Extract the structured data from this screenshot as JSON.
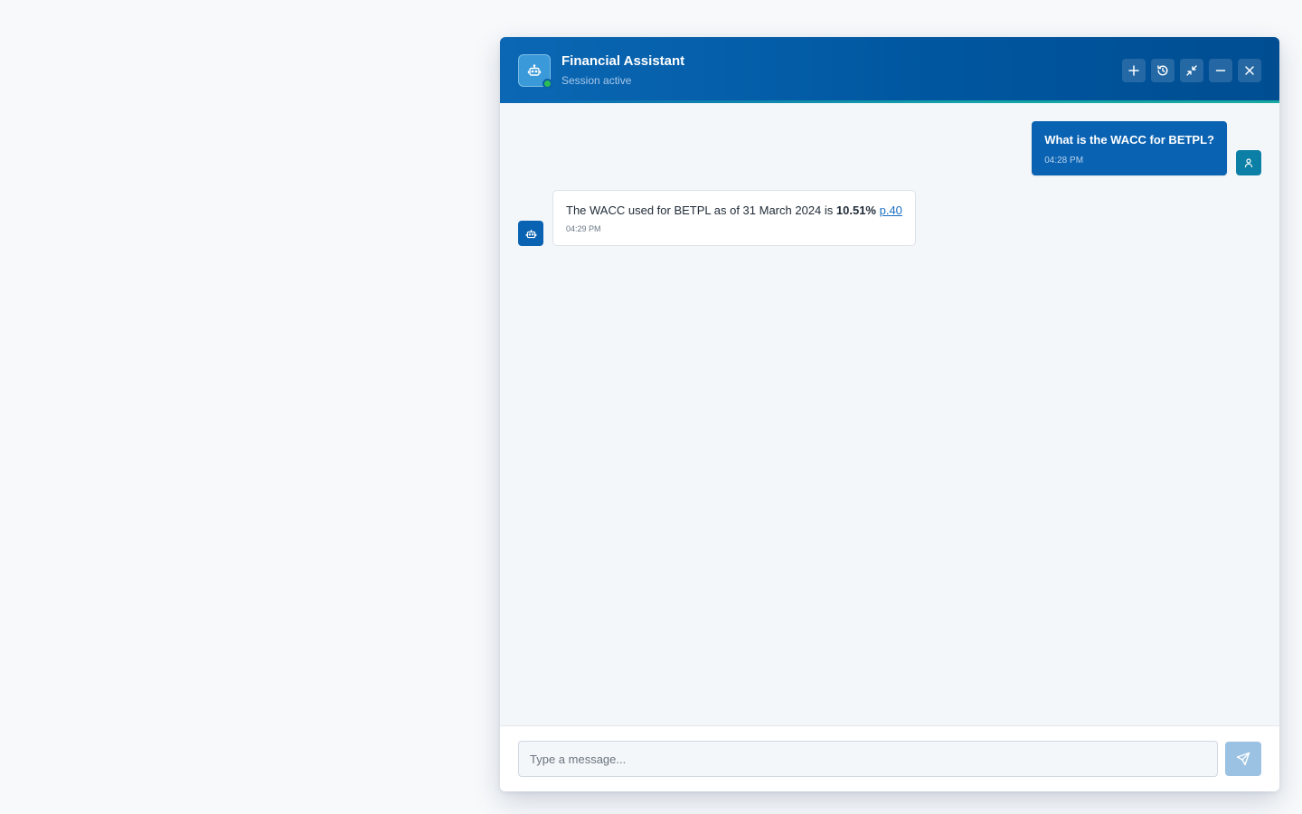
{
  "header": {
    "title": "Financial Assistant",
    "subtitle": "Session active",
    "actions": [
      {
        "name": "new-chat",
        "icon": "plus-icon"
      },
      {
        "name": "history",
        "icon": "history-icon"
      },
      {
        "name": "collapse",
        "icon": "minimize-arrows-icon"
      },
      {
        "name": "minimize",
        "icon": "minus-icon"
      },
      {
        "name": "close",
        "icon": "close-icon"
      }
    ]
  },
  "messages": [
    {
      "role": "user",
      "text": "What is the WACC for BETPL?",
      "time": "04:28 PM"
    },
    {
      "role": "assistant",
      "text_before": "The WACC used for BETPL as of 31 March 2024 is ",
      "text_bold": "10.51%",
      "text_between": " ",
      "link": "p.40",
      "time": "04:29 PM"
    }
  ],
  "composer": {
    "placeholder": "Type a message..."
  },
  "colors": {
    "header": "#0057a0",
    "accent_strip": "#16a9a0",
    "user_bubble": "#0a63b2",
    "status_online": "#2bbd52",
    "send_button": "#9cc2e3"
  }
}
